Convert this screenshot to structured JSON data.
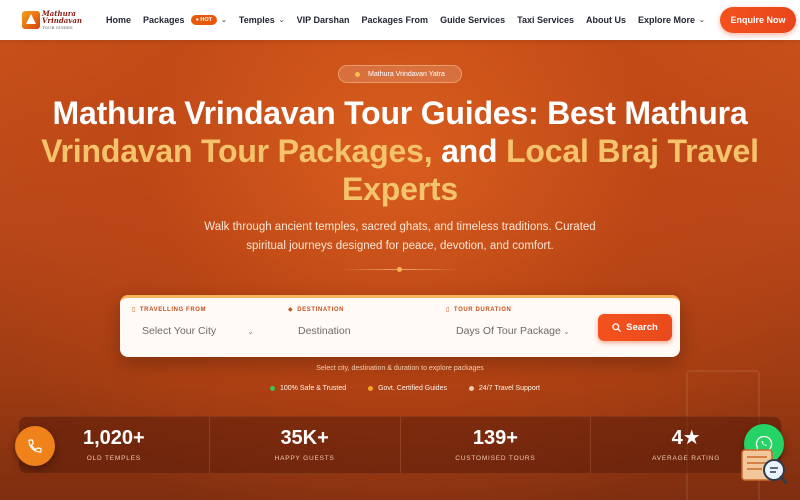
{
  "brand": {
    "logo_line1": "Mathura",
    "logo_line2": "Vrindavan",
    "logo_tagline": "TOUR GUIDES"
  },
  "nav": {
    "items": [
      {
        "label": "Home",
        "dropdown": false
      },
      {
        "label": "Packages",
        "dropdown": true,
        "badge": "HOT"
      },
      {
        "label": "Temples",
        "dropdown": true
      },
      {
        "label": "VIP Darshan",
        "dropdown": false
      },
      {
        "label": "Packages From",
        "dropdown": false
      },
      {
        "label": "Guide Services",
        "dropdown": false
      },
      {
        "label": "Taxi Services",
        "dropdown": false
      },
      {
        "label": "About Us",
        "dropdown": false
      },
      {
        "label": "Explore More",
        "dropdown": true
      }
    ],
    "cta_label": "Enquire Now"
  },
  "hero": {
    "pill_label": "Mathura Vrindavan Yatra",
    "title_part1": "Mathura Vrindavan Tour Guides: Best Mathura",
    "title_gold1": "Vrindavan Tour Packages,",
    "title_part2": " and ",
    "title_gold2": "Local Braj Travel",
    "title_gold3": "Experts",
    "subtitle_line1": "Walk through ancient temples, sacred ghats, and timeless traditions.  Curated",
    "subtitle_line2": "spiritual journeys designed for peace, devotion, and comfort."
  },
  "search": {
    "from_label": "TRAVELLING FROM",
    "from_value": "Select Your City",
    "destination_label": "DESTINATION",
    "destination_placeholder": "Destination",
    "duration_label": "TOUR DURATION",
    "duration_value": "Days Of Tour Package",
    "button_label": "Search",
    "hint": "Select city, destination & duration to explore packages"
  },
  "trust_badges": [
    {
      "label": "100% Safe & Trusted",
      "color": "#3fbf5a"
    },
    {
      "label": "Govt. Certified Guides",
      "color": "#f5a623"
    },
    {
      "label": "24/7 Travel Support",
      "color": "#f3c9a8"
    }
  ],
  "stats": [
    {
      "value": "1,020+",
      "label": "OLD TEMPLES"
    },
    {
      "value": "35K+",
      "label": "HAPPY GUESTS"
    },
    {
      "value": "139+",
      "label": "CUSTOMISED TOURS"
    },
    {
      "value": "4★",
      "label": "AVERAGE RATING"
    }
  ],
  "colors": {
    "accent": "#ea580c",
    "gold": "#f5c36b",
    "hero_bg": "#b8471a",
    "whatsapp": "#25d366"
  }
}
